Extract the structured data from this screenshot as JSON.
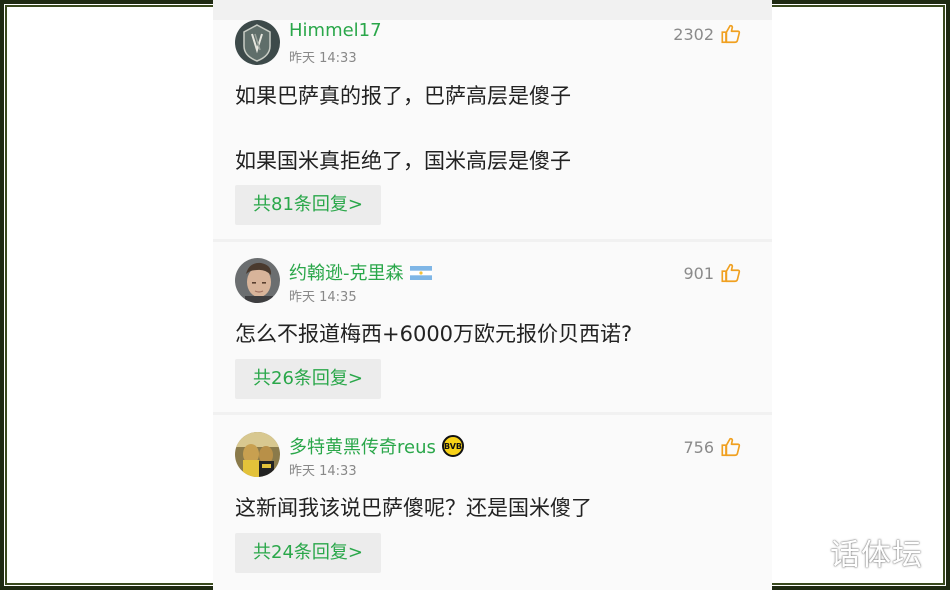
{
  "comments": [
    {
      "username": "Himmel17",
      "time": "昨天 14:33",
      "likes": "2302",
      "lines": [
        "如果巴萨真的报了，巴萨高层是傻子",
        "如果国米真拒绝了，国米高层是傻子"
      ],
      "reply_label": "共81条回复>"
    },
    {
      "username": "约翰逊-克里森",
      "time": "昨天 14:35",
      "likes": "901",
      "lines": [
        "怎么不报道梅西+6000万欧元报价贝西诺?"
      ],
      "reply_label": "共26条回复>",
      "badge": "argentina-flag-icon"
    },
    {
      "username": "多特黄黑传奇reus",
      "time": "昨天 14:33",
      "likes": "756",
      "lines": [
        "这新闻我该说巴萨傻呢？还是国米傻了"
      ],
      "reply_label": "共24条回复>",
      "badge": "bvb-logo-icon"
    }
  ],
  "watermark": "话体坛",
  "colors": {
    "username": "#2aa74a",
    "like": "#f0a020",
    "text": "#222222",
    "meta": "#888888"
  }
}
